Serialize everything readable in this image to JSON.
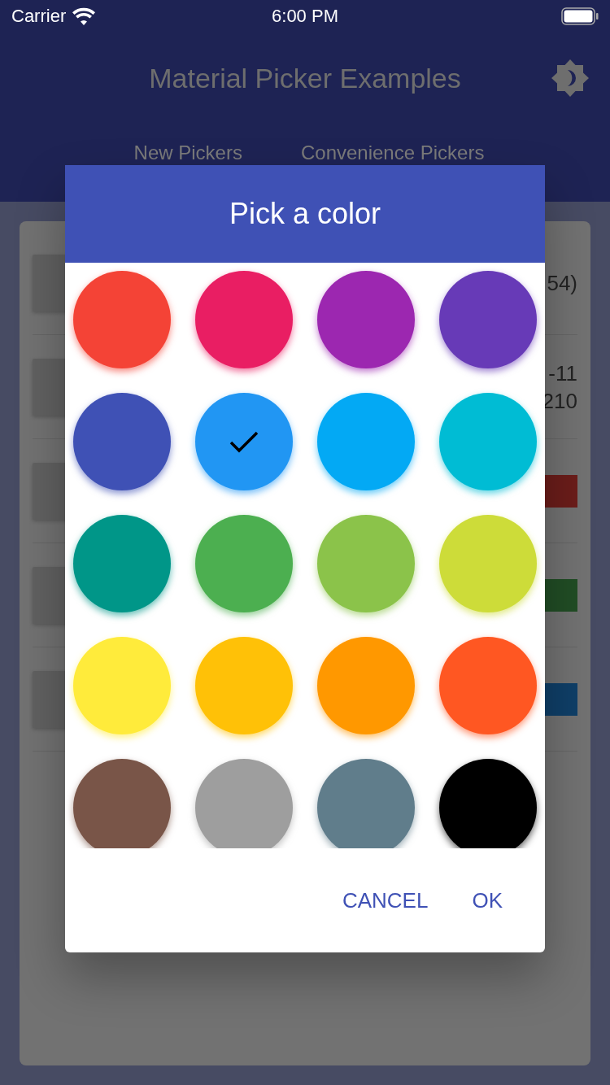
{
  "status_bar": {
    "carrier": "Carrier",
    "time": "6:00 PM"
  },
  "app_bar": {
    "title": "Material Picker Examples"
  },
  "tabs": [
    {
      "label": "New Pickers"
    },
    {
      "label": "Convenience Pickers"
    }
  ],
  "background_rows": [
    {
      "kind": "text",
      "lines": [
        "54)"
      ]
    },
    {
      "kind": "text",
      "lines": [
        "-11",
        "210"
      ]
    },
    {
      "kind": "bar",
      "color": "#6b1d1a"
    },
    {
      "kind": "bar",
      "color": "#214d25"
    },
    {
      "kind": "bar",
      "color": "#0f3f68"
    }
  ],
  "dialog": {
    "title": "Pick a color",
    "colors": [
      {
        "color": "#f44336",
        "selected": false
      },
      {
        "color": "#e91e63",
        "selected": false
      },
      {
        "color": "#9c27b0",
        "selected": false
      },
      {
        "color": "#673ab7",
        "selected": false
      },
      {
        "color": "#3f51b5",
        "selected": false
      },
      {
        "color": "#2196f3",
        "selected": true
      },
      {
        "color": "#03a9f4",
        "selected": false
      },
      {
        "color": "#00bcd4",
        "selected": false
      },
      {
        "color": "#009688",
        "selected": false
      },
      {
        "color": "#4caf50",
        "selected": false
      },
      {
        "color": "#8bc34a",
        "selected": false
      },
      {
        "color": "#cddc39",
        "selected": false
      },
      {
        "color": "#ffeb3b",
        "selected": false
      },
      {
        "color": "#ffc107",
        "selected": false
      },
      {
        "color": "#ff9800",
        "selected": false
      },
      {
        "color": "#ff5722",
        "selected": false
      },
      {
        "color": "#795548",
        "selected": false
      },
      {
        "color": "#9e9e9e",
        "selected": false
      },
      {
        "color": "#607d8b",
        "selected": false
      },
      {
        "color": "#000000",
        "selected": false
      }
    ],
    "buttons": [
      "CANCEL",
      "OK"
    ]
  }
}
